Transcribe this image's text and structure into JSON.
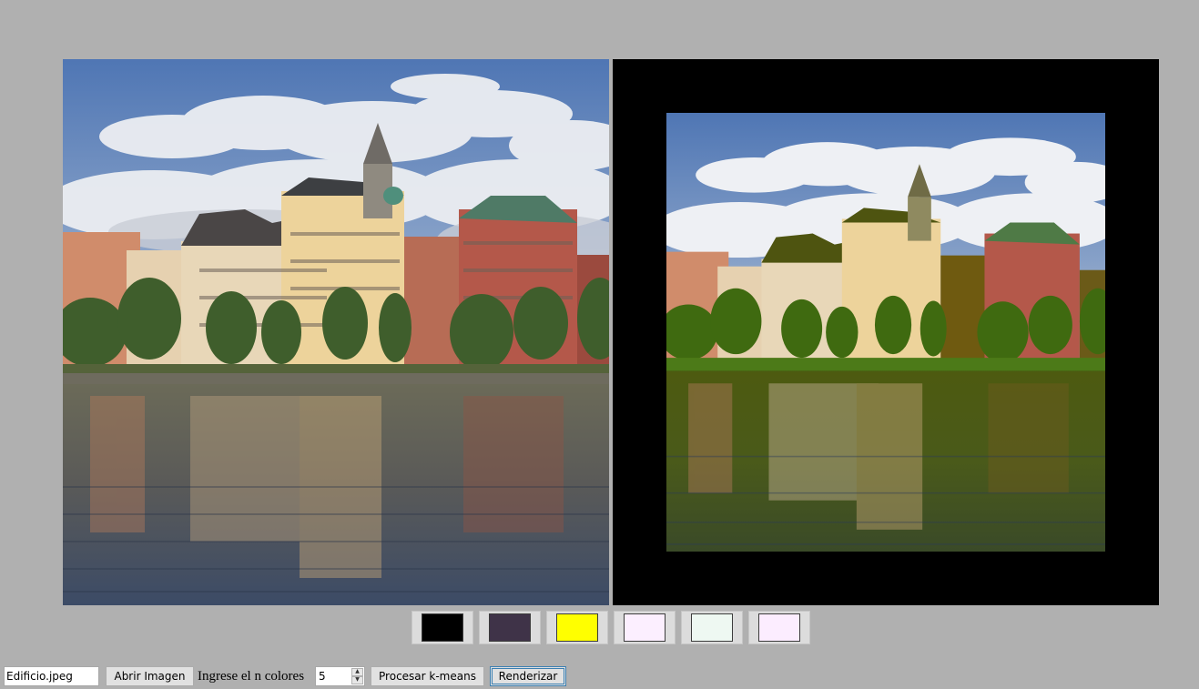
{
  "palette": {
    "swatches": [
      {
        "name": "swatch-1",
        "color": "#000000"
      },
      {
        "name": "swatch-2",
        "color": "#3f3348"
      },
      {
        "name": "swatch-3",
        "color": "#ffff00"
      },
      {
        "name": "swatch-4",
        "color": "#fcefff"
      },
      {
        "name": "swatch-5",
        "color": "#eef8f2"
      },
      {
        "name": "swatch-6",
        "color": "#fcedff"
      }
    ]
  },
  "toolbar": {
    "file_name": "Edificio.jpeg",
    "open_image_label": "Abrir Imagen",
    "colors_label": "Ingrese el n colores",
    "colors_value": "5",
    "process_label": "Procesar k-means",
    "render_label": "Renderizar"
  }
}
